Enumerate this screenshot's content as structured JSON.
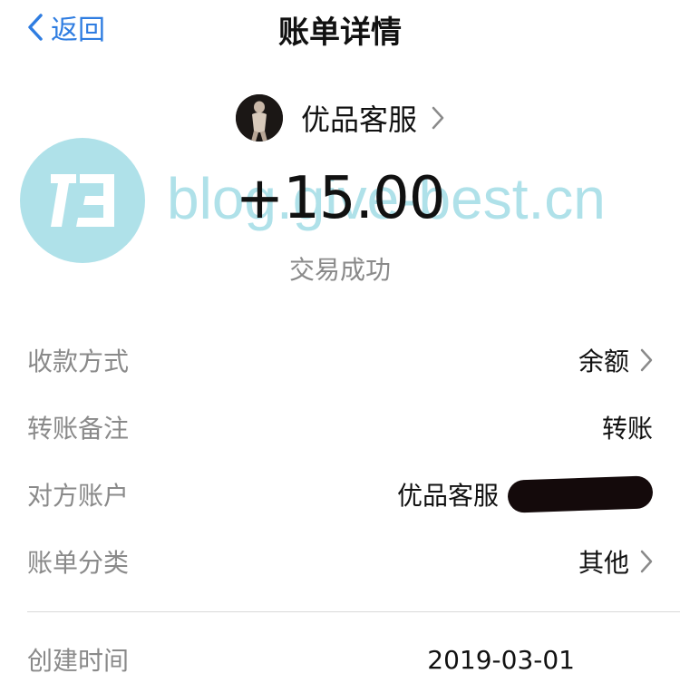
{
  "header": {
    "back_label": "返回",
    "title": "账单详情"
  },
  "merchant": {
    "name": "优品客服"
  },
  "transaction": {
    "amount": "+15.00",
    "status": "交易成功"
  },
  "watermark": {
    "text": "blog.give-best.cn"
  },
  "details": [
    {
      "label": "收款方式",
      "value": "余额",
      "chevron": true
    },
    {
      "label": "转账备注",
      "value": "转账",
      "chevron": false
    },
    {
      "label": "对方账户",
      "value": "优品客服",
      "redacted": true
    },
    {
      "label": "账单分类",
      "value": "其他",
      "chevron": true
    }
  ],
  "created": {
    "label": "创建时间",
    "value": "2019-03-01"
  },
  "colors": {
    "accent": "#2f7de1",
    "label_gray": "#8a8a8a",
    "watermark": "#6ec8d7"
  }
}
